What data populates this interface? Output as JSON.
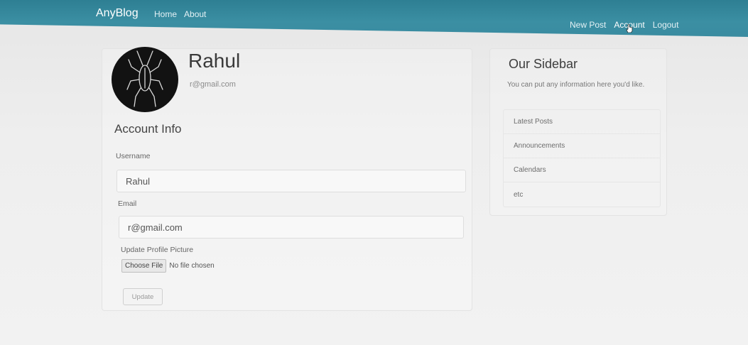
{
  "navbar": {
    "brand": "AnyBlog",
    "left_links": [
      "Home",
      "About"
    ],
    "right_links": [
      "New Post",
      "Account",
      "Logout"
    ],
    "active": "Account",
    "color": "#3b8fa3"
  },
  "profile": {
    "name": "Rahul",
    "email": "r@gmail.com",
    "avatar_icon": "cockroach-silhouette-icon"
  },
  "form": {
    "section_title": "Account Info",
    "username_label": "Username",
    "username_value": "Rahul",
    "email_label": "Email",
    "email_value": "r@gmail.com",
    "picture_label": "Update Profile Picture",
    "choose_file": "Choose File",
    "file_status": "No file chosen",
    "submit": "Update"
  },
  "sidebar": {
    "title": "Our Sidebar",
    "text": "You can put any information here you'd like.",
    "items": [
      "Latest Posts",
      "Announcements",
      "Calendars",
      "etc"
    ]
  }
}
